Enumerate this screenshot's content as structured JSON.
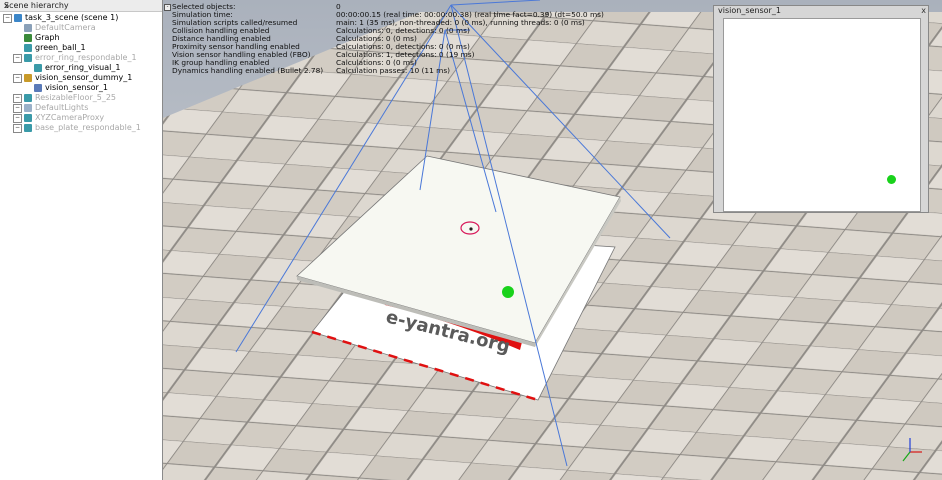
{
  "hierarchy": {
    "title": "Scene hierarchy",
    "close_glyph": "x",
    "items": [
      {
        "label": "task_3_scene (scene 1)",
        "icon": "scene-icon"
      },
      {
        "label": "DefaultCamera",
        "icon": "camera-icon"
      },
      {
        "label": "Graph",
        "icon": "graph-icon"
      },
      {
        "label": "green_ball_1",
        "icon": "shape-icon"
      },
      {
        "label": "error_ring_respondable_1",
        "icon": "shape-icon"
      },
      {
        "label": "error_ring_visual_1",
        "icon": "shape-icon"
      },
      {
        "label": "vision_sensor_dummy_1",
        "icon": "dummy-icon"
      },
      {
        "label": "vision_sensor_1",
        "icon": "vision-sensor-icon"
      },
      {
        "label": "ResizableFloor_5_25",
        "icon": "shape-icon"
      },
      {
        "label": "DefaultLights",
        "icon": "light-icon"
      },
      {
        "label": "XYZCameraProxy",
        "icon": "shape-icon"
      },
      {
        "label": "base_plate_respondable_1",
        "icon": "shape-icon"
      }
    ]
  },
  "info": {
    "toggle": "-",
    "rows": [
      {
        "key": "Selected objects:",
        "value": "0"
      },
      {
        "key": "Simulation time:",
        "value": "00:00:00.15 (real time: 00:00:00.38) (real time fact=0.39) (dt=50.0 ms)"
      },
      {
        "key": "Simulation scripts called/resumed",
        "value": "main: 1 (35 ms), non-threaded: 0 (0 ms), running threads: 0 (0 ms)"
      },
      {
        "key": "Collision handling enabled",
        "value": "Calculations: 0, detections: 0 (0 ms)"
      },
      {
        "key": "Distance handling enabled",
        "value": "Calculations: 0 (0 ms)"
      },
      {
        "key": "Proximity sensor handling enabled",
        "value": "Calculations: 0, detections: 0 (0 ms)"
      },
      {
        "key": "Vision sensor handling enabled (FBO)",
        "value": "Calculations: 1, detections: 0 (19 ms)"
      },
      {
        "key": "IK group handling enabled",
        "value": "Calculations: 0 (0 ms)"
      },
      {
        "key": "Dynamics handling enabled (Bullet 2.78)",
        "value": "Calculation passes: 10 (11 ms)"
      }
    ]
  },
  "scene": {
    "logo_text": "e-yantra.org"
  },
  "vision_window": {
    "title": "vision_sensor_1",
    "close_glyph": "x"
  },
  "colors": {
    "ball": "#19d21b",
    "ring": "#d8185a",
    "sensor_lines": "#4a78d8",
    "logo_red": "#e01010"
  }
}
